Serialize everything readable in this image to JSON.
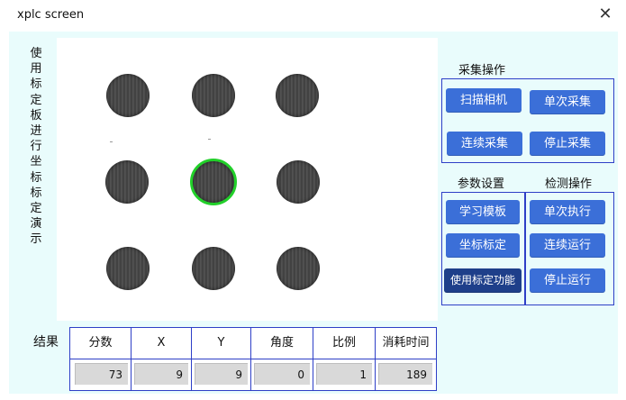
{
  "window": {
    "title": "xplc screen"
  },
  "vertical_caption": [
    "使",
    "用",
    "标",
    "定",
    "板",
    "进",
    "行",
    "坐",
    "标",
    "标",
    "定",
    "演",
    "示"
  ],
  "groups": {
    "capture": {
      "label": "采集操作",
      "buttons": [
        "扫描相机",
        "单次采集",
        "连续采集",
        "停止采集"
      ]
    },
    "params": {
      "label": "参数设置",
      "buttons": [
        "学习模板",
        "坐标标定",
        "使用标定功能"
      ]
    },
    "detect": {
      "label": "检测操作",
      "buttons": [
        "单次执行",
        "连续运行",
        "停止运行"
      ]
    }
  },
  "results": {
    "label": "结果",
    "headers": [
      "分数",
      "X",
      "Y",
      "角度",
      "比例",
      "消耗时间"
    ],
    "values": [
      "73",
      "9",
      "9",
      "0",
      "1",
      "189"
    ]
  },
  "colors": {
    "panel_bg": "#e9fcfc",
    "button": "#3b6fd8",
    "button_active": "#1e3f8a",
    "border": "#2e3fc7",
    "selection": "#22d02a"
  },
  "icons": {
    "close": "close-icon"
  }
}
